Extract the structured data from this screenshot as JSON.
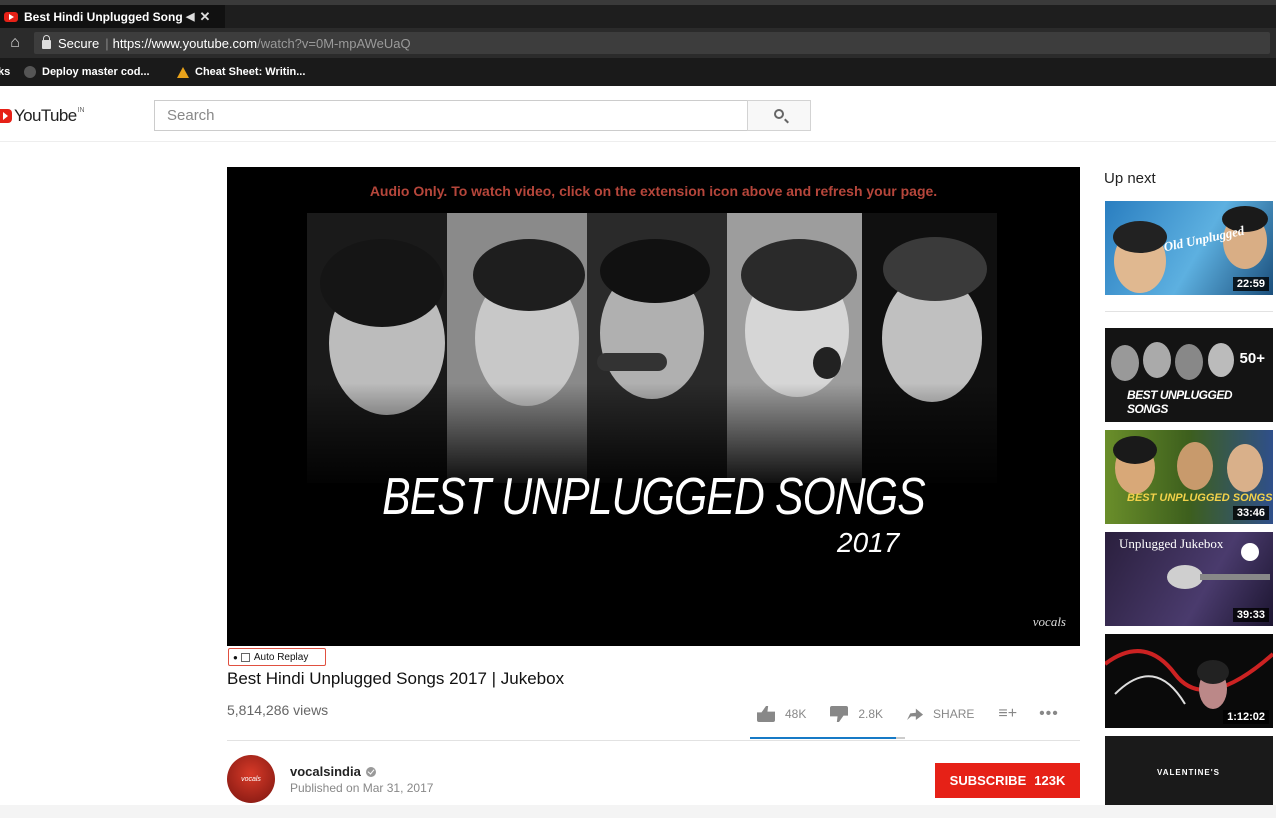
{
  "browser": {
    "tab_title": "Best Hindi Unplugged Song",
    "tab_mute": "◀",
    "tab_close": "✕",
    "secure_label": "Secure",
    "url_host": "https://www.youtube.com",
    "url_path": "/watch?v=0M-mpAWeUaQ",
    "bookmarks": [
      {
        "label": "ks"
      },
      {
        "label": "Deploy master cod..."
      },
      {
        "label": "Cheat Sheet: Writin..."
      }
    ]
  },
  "header": {
    "logo_text": "YouTube",
    "logo_region": "IN",
    "search_placeholder": "Search"
  },
  "player": {
    "audio_notice": "Audio Only. To watch video, click on the extension icon above and refresh your page.",
    "overlay_title": "BEST UNPLUGGED SONGS",
    "overlay_year": "2017",
    "watermark": "vocals"
  },
  "auto_replay_label": "Auto Replay",
  "video": {
    "title": "Best Hindi Unplugged Songs 2017 | Jukebox",
    "views": "5,814,286 views",
    "likes": "48K",
    "dislikes": "2.8K",
    "share_label": "SHARE",
    "like_ratio": 0.945
  },
  "channel": {
    "name": "vocalsindia",
    "avatar_text": "vocals",
    "published": "Published on Mar 31, 2017",
    "subscribe_label": "SUBSCRIBE",
    "subscriber_count": "123K"
  },
  "up_next": {
    "label": "Up next",
    "items": [
      {
        "duration": "22:59",
        "caption": "Old Unplugged"
      },
      {
        "duration": "",
        "caption": "BEST UNPLUGGED SONGS",
        "badge": "50+"
      },
      {
        "duration": "33:46",
        "caption": "BEST UNPLUGGED SONGS"
      },
      {
        "duration": "39:33",
        "caption": "Unplugged Jukebox"
      },
      {
        "duration": "1:12:02",
        "caption": ""
      },
      {
        "duration": "",
        "caption": "VALENTINE'S"
      }
    ]
  },
  "colors": {
    "brand_red": "#e62117",
    "like_bar": "#167ac6",
    "notice_red": "#b6463b"
  }
}
